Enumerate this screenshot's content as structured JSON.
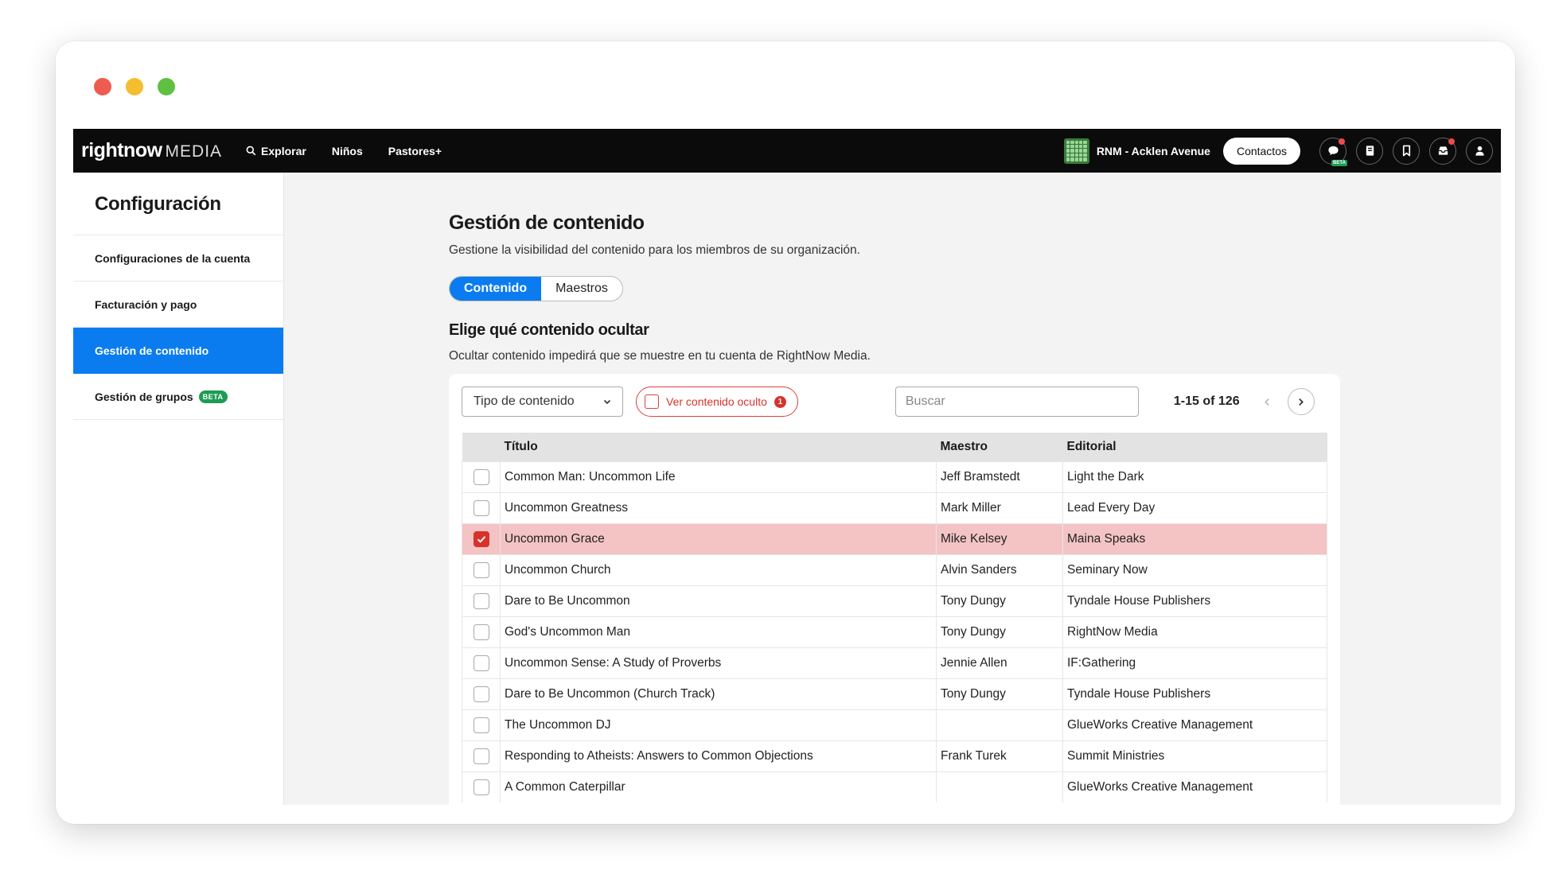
{
  "nav": {
    "logo_main": "rightnow",
    "logo_sub": "MEDIA",
    "links": [
      "Explorar",
      "Niños",
      "Pastores+"
    ],
    "org_name": "RNM - Acklen Avenue",
    "contacts_label": "Contactos",
    "chat_badge": "BETA"
  },
  "sidebar": {
    "title": "Configuración",
    "items": [
      "Configuraciones de la cuenta",
      "Facturación y pago",
      "Gestión de contenido",
      "Gestión de grupos"
    ],
    "active_index": 2,
    "groups_badge": "BETA"
  },
  "main": {
    "title": "Gestión de contenido",
    "subtitle": "Gestione la visibilidad del contenido para los miembros de su organización.",
    "tabs": [
      "Contenido",
      "Maestros"
    ],
    "active_tab": 0,
    "section_title": "Elige qué contenido ocultar",
    "section_subtitle": "Ocultar contenido impedirá que se muestre en tu cuenta de RightNow Media."
  },
  "toolbar": {
    "type_select": "Tipo de contenido",
    "hidden_label": "Ver contenido oculto",
    "hidden_count": "1",
    "search_placeholder": "Buscar",
    "pager_text": "1-15 of 126"
  },
  "table": {
    "headers": [
      "Título",
      "Maestro",
      "Editorial"
    ],
    "rows": [
      {
        "title": "Common Man: Uncommon Life",
        "teacher": "Jeff Bramstedt",
        "publisher": "Light the Dark",
        "checked": false
      },
      {
        "title": "Uncommon Greatness",
        "teacher": "Mark Miller",
        "publisher": "Lead Every Day",
        "checked": false
      },
      {
        "title": "Uncommon Grace",
        "teacher": "Mike Kelsey",
        "publisher": "Maina Speaks",
        "checked": true
      },
      {
        "title": "Uncommon Church",
        "teacher": "Alvin Sanders",
        "publisher": "Seminary Now",
        "checked": false
      },
      {
        "title": "Dare to Be Uncommon",
        "teacher": "Tony Dungy",
        "publisher": "Tyndale House Publishers",
        "checked": false
      },
      {
        "title": "God's Uncommon Man",
        "teacher": "Tony Dungy",
        "publisher": "RightNow Media",
        "checked": false
      },
      {
        "title": "Uncommon Sense: A Study of Proverbs",
        "teacher": "Jennie Allen",
        "publisher": "IF:Gathering",
        "checked": false
      },
      {
        "title": "Dare to Be Uncommon (Church Track)",
        "teacher": "Tony Dungy",
        "publisher": "Tyndale House Publishers",
        "checked": false
      },
      {
        "title": "The Uncommon DJ",
        "teacher": "",
        "publisher": "GlueWorks Creative Management",
        "checked": false
      },
      {
        "title": "Responding to Atheists: Answers to Common Objections",
        "teacher": "Frank Turek",
        "publisher": "Summit Ministries",
        "checked": false
      },
      {
        "title": "A Common Caterpillar",
        "teacher": "",
        "publisher": "GlueWorks Creative Management",
        "checked": false
      }
    ]
  },
  "colors": {
    "accent": "#0a7cf0",
    "danger": "#d8322b",
    "selected_row": "#f4c4c4",
    "beta_green": "#1d9c54"
  }
}
